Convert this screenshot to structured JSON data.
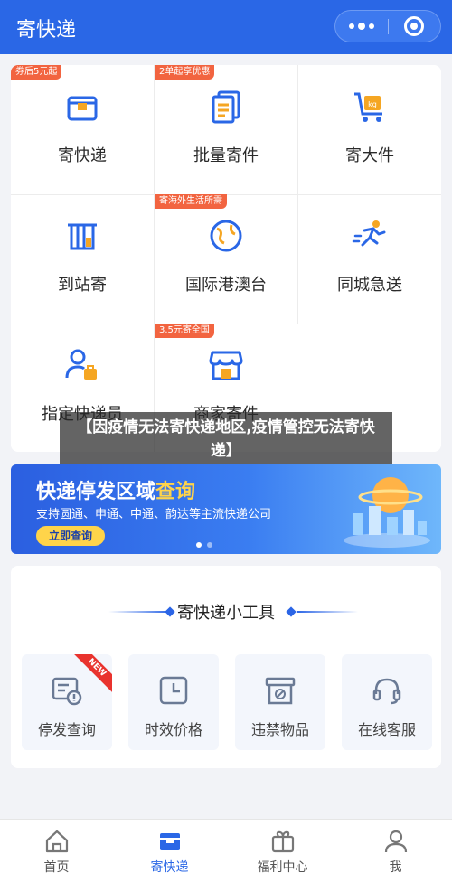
{
  "header": {
    "title": "寄快递"
  },
  "services": [
    {
      "label": "寄快递",
      "tag": "券后5元起",
      "icon": "parcel-box-icon"
    },
    {
      "label": "批量寄件",
      "tag": "2单起享优惠",
      "icon": "document-stack-icon"
    },
    {
      "label": "寄大件",
      "tag": "",
      "icon": "kg-cart-icon"
    },
    {
      "label": "到站寄",
      "tag": "",
      "icon": "station-icon"
    },
    {
      "label": "国际港澳台",
      "tag": "寄海外生活所需",
      "icon": "globe-icon"
    },
    {
      "label": "同城急送",
      "tag": "",
      "icon": "runner-icon"
    },
    {
      "label": "指定快递员",
      "tag": "",
      "icon": "courier-person-icon"
    },
    {
      "label": "商家寄件",
      "tag": "3.5元寄全国",
      "icon": "shop-icon"
    }
  ],
  "overlay_caption": "【因疫情无法寄快递地区,疫情管控无法寄快递】",
  "banner": {
    "title_main": "快递停发区域",
    "title_highlight": "查询",
    "subtitle": "支持圆通、申通、中通、韵达等主流快递公司",
    "button": "立即查询"
  },
  "tools": {
    "title": "寄快递小工具",
    "items": [
      {
        "label": "停发查询",
        "icon": "suspend-query-icon",
        "badge": "NEW"
      },
      {
        "label": "时效价格",
        "icon": "clock-icon",
        "badge": ""
      },
      {
        "label": "违禁物品",
        "icon": "prohibited-box-icon",
        "badge": ""
      },
      {
        "label": "在线客服",
        "icon": "headset-icon",
        "badge": ""
      }
    ]
  },
  "tabbar": {
    "items": [
      {
        "label": "首页",
        "icon": "home-icon",
        "active": false
      },
      {
        "label": "寄快递",
        "icon": "parcel-icon",
        "active": true
      },
      {
        "label": "福利中心",
        "icon": "gift-icon",
        "active": false
      },
      {
        "label": "我",
        "icon": "user-icon",
        "active": false
      }
    ]
  },
  "colors": {
    "brand_blue": "#2a67e6",
    "tag_orange": "#f26440",
    "highlight_yellow": "#ffd44a"
  }
}
